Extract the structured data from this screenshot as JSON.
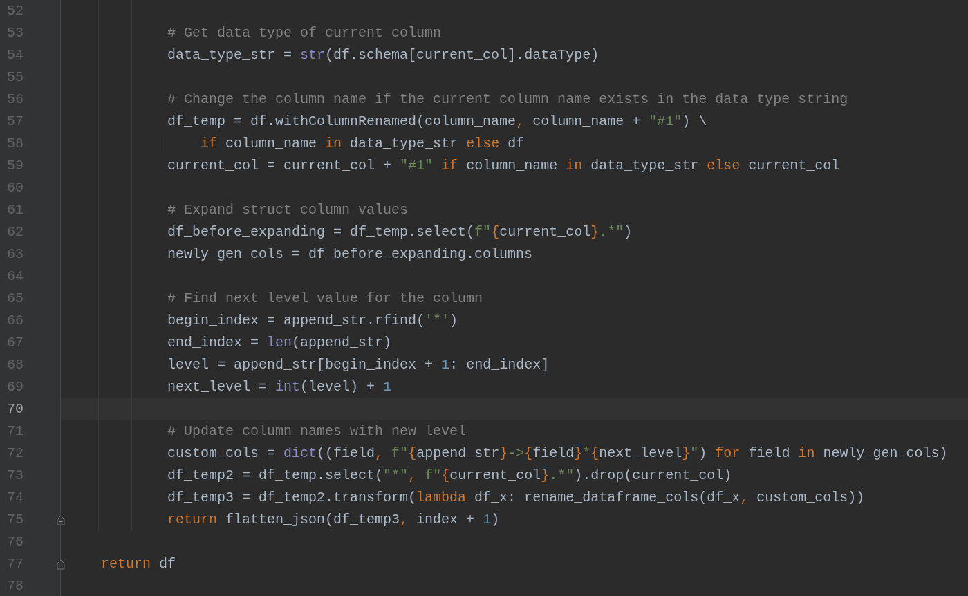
{
  "editor": {
    "lines": [
      {
        "number": "52",
        "current": false,
        "fold": false
      },
      {
        "number": "53",
        "current": false,
        "fold": false,
        "tokens": [
          {
            "kind": "comment",
            "text": "            # Get data type of current column"
          }
        ]
      },
      {
        "number": "54",
        "current": false,
        "fold": false,
        "tokens": [
          {
            "kind": "plain",
            "text": "            data_type_str = "
          },
          {
            "kind": "builtin",
            "text": "str"
          },
          {
            "kind": "plain",
            "text": "(df.schema[current_col].dataType)"
          }
        ]
      },
      {
        "number": "55",
        "current": false,
        "fold": false
      },
      {
        "number": "56",
        "current": false,
        "fold": false,
        "tokens": [
          {
            "kind": "comment",
            "text": "            # Change the column name if the current column name exists in the data type string"
          }
        ]
      },
      {
        "number": "57",
        "current": false,
        "fold": false,
        "tokens": [
          {
            "kind": "plain",
            "text": "            df_temp = df.withColumnRenamed(column_name"
          },
          {
            "kind": "punct",
            "text": ","
          },
          {
            "kind": "plain",
            "text": " column_name + "
          },
          {
            "kind": "string",
            "text": "\"#1\""
          },
          {
            "kind": "plain",
            "text": ") \\"
          }
        ]
      },
      {
        "number": "58",
        "current": false,
        "fold": false,
        "tokens": [
          {
            "kind": "keyword",
            "text": "                if"
          },
          {
            "kind": "plain",
            "text": " column_name "
          },
          {
            "kind": "keyword",
            "text": "in"
          },
          {
            "kind": "plain",
            "text": " data_type_str "
          },
          {
            "kind": "keyword",
            "text": "else"
          },
          {
            "kind": "plain",
            "text": " df"
          }
        ]
      },
      {
        "number": "59",
        "current": false,
        "fold": false,
        "tokens": [
          {
            "kind": "plain",
            "text": "            current_col = current_col + "
          },
          {
            "kind": "string",
            "text": "\"#1\""
          },
          {
            "kind": "keyword",
            "text": " if"
          },
          {
            "kind": "plain",
            "text": " column_name "
          },
          {
            "kind": "keyword",
            "text": "in"
          },
          {
            "kind": "plain",
            "text": " data_type_str "
          },
          {
            "kind": "keyword",
            "text": "else"
          },
          {
            "kind": "plain",
            "text": " current_col"
          }
        ]
      },
      {
        "number": "60",
        "current": false,
        "fold": false
      },
      {
        "number": "61",
        "current": false,
        "fold": false,
        "tokens": [
          {
            "kind": "comment",
            "text": "            # Expand struct column values"
          }
        ]
      },
      {
        "number": "62",
        "current": false,
        "fold": false,
        "tokens": [
          {
            "kind": "plain",
            "text": "            df_before_expanding = df_temp.select("
          },
          {
            "kind": "string",
            "text": "f\""
          },
          {
            "kind": "brace",
            "text": "{"
          },
          {
            "kind": "plain",
            "text": "current_col"
          },
          {
            "kind": "brace",
            "text": "}"
          },
          {
            "kind": "string",
            "text": ".*\""
          },
          {
            "kind": "plain",
            "text": ")"
          }
        ]
      },
      {
        "number": "63",
        "current": false,
        "fold": false,
        "tokens": [
          {
            "kind": "plain",
            "text": "            newly_gen_cols = df_before_expanding.columns"
          }
        ]
      },
      {
        "number": "64",
        "current": false,
        "fold": false
      },
      {
        "number": "65",
        "current": false,
        "fold": false,
        "tokens": [
          {
            "kind": "comment",
            "text": "            # Find next level value for the column"
          }
        ]
      },
      {
        "number": "66",
        "current": false,
        "fold": false,
        "tokens": [
          {
            "kind": "plain",
            "text": "            begin_index = append_str.rfind("
          },
          {
            "kind": "string",
            "text": "'*'"
          },
          {
            "kind": "plain",
            "text": ")"
          }
        ]
      },
      {
        "number": "67",
        "current": false,
        "fold": false,
        "tokens": [
          {
            "kind": "plain",
            "text": "            end_index = "
          },
          {
            "kind": "builtin",
            "text": "len"
          },
          {
            "kind": "plain",
            "text": "(append_str)"
          }
        ]
      },
      {
        "number": "68",
        "current": false,
        "fold": false,
        "tokens": [
          {
            "kind": "plain",
            "text": "            level = append_str[begin_index + "
          },
          {
            "kind": "number",
            "text": "1"
          },
          {
            "kind": "plain",
            "text": ": end_index]"
          }
        ]
      },
      {
        "number": "69",
        "current": false,
        "fold": false,
        "tokens": [
          {
            "kind": "plain",
            "text": "            next_level = "
          },
          {
            "kind": "builtin",
            "text": "int"
          },
          {
            "kind": "plain",
            "text": "(level) + "
          },
          {
            "kind": "number",
            "text": "1"
          }
        ]
      },
      {
        "number": "70",
        "current": true,
        "fold": false
      },
      {
        "number": "71",
        "current": false,
        "fold": false,
        "tokens": [
          {
            "kind": "comment",
            "text": "            # Update column names with new level"
          }
        ]
      },
      {
        "number": "72",
        "current": false,
        "fold": false,
        "tokens": [
          {
            "kind": "plain",
            "text": "            custom_cols = "
          },
          {
            "kind": "builtin",
            "text": "dict"
          },
          {
            "kind": "plain",
            "text": "((field"
          },
          {
            "kind": "punct",
            "text": ","
          },
          {
            "kind": "string",
            "text": " f\""
          },
          {
            "kind": "brace",
            "text": "{"
          },
          {
            "kind": "plain",
            "text": "append_str"
          },
          {
            "kind": "brace",
            "text": "}"
          },
          {
            "kind": "string",
            "text": "->"
          },
          {
            "kind": "brace",
            "text": "{"
          },
          {
            "kind": "plain",
            "text": "field"
          },
          {
            "kind": "brace",
            "text": "}"
          },
          {
            "kind": "string",
            "text": "*"
          },
          {
            "kind": "brace",
            "text": "{"
          },
          {
            "kind": "plain",
            "text": "next_level"
          },
          {
            "kind": "brace",
            "text": "}"
          },
          {
            "kind": "string",
            "text": "\""
          },
          {
            "kind": "plain",
            "text": ") "
          },
          {
            "kind": "keyword",
            "text": "for"
          },
          {
            "kind": "plain",
            "text": " field "
          },
          {
            "kind": "keyword",
            "text": "in"
          },
          {
            "kind": "plain",
            "text": " newly_gen_cols)"
          }
        ]
      },
      {
        "number": "73",
        "current": false,
        "fold": false,
        "tokens": [
          {
            "kind": "plain",
            "text": "            df_temp2 = df_temp.select("
          },
          {
            "kind": "string",
            "text": "\"*\""
          },
          {
            "kind": "punct",
            "text": ","
          },
          {
            "kind": "string",
            "text": " f\""
          },
          {
            "kind": "brace",
            "text": "{"
          },
          {
            "kind": "plain",
            "text": "current_col"
          },
          {
            "kind": "brace",
            "text": "}"
          },
          {
            "kind": "string",
            "text": ".*\""
          },
          {
            "kind": "plain",
            "text": ").drop(current_col)"
          }
        ]
      },
      {
        "number": "74",
        "current": false,
        "fold": false,
        "tokens": [
          {
            "kind": "plain",
            "text": "            df_temp3 = df_temp2.transform("
          },
          {
            "kind": "keyword",
            "text": "lambda"
          },
          {
            "kind": "plain",
            "text": " df_x: rename_dataframe_cols(df_x"
          },
          {
            "kind": "punct",
            "text": ","
          },
          {
            "kind": "plain",
            "text": " custom_cols))"
          }
        ]
      },
      {
        "number": "75",
        "current": false,
        "fold": true,
        "tokens": [
          {
            "kind": "keyword",
            "text": "            return"
          },
          {
            "kind": "plain",
            "text": " flatten_json(df_temp3"
          },
          {
            "kind": "punct",
            "text": ","
          },
          {
            "kind": "plain",
            "text": " index + "
          },
          {
            "kind": "number",
            "text": "1"
          },
          {
            "kind": "plain",
            "text": ")"
          }
        ]
      },
      {
        "number": "76",
        "current": false,
        "fold": false
      },
      {
        "number": "77",
        "current": false,
        "fold": true,
        "tokens": [
          {
            "kind": "keyword",
            "text": "    return"
          },
          {
            "kind": "plain",
            "text": " df"
          }
        ]
      },
      {
        "number": "78",
        "current": false,
        "fold": false
      }
    ]
  }
}
